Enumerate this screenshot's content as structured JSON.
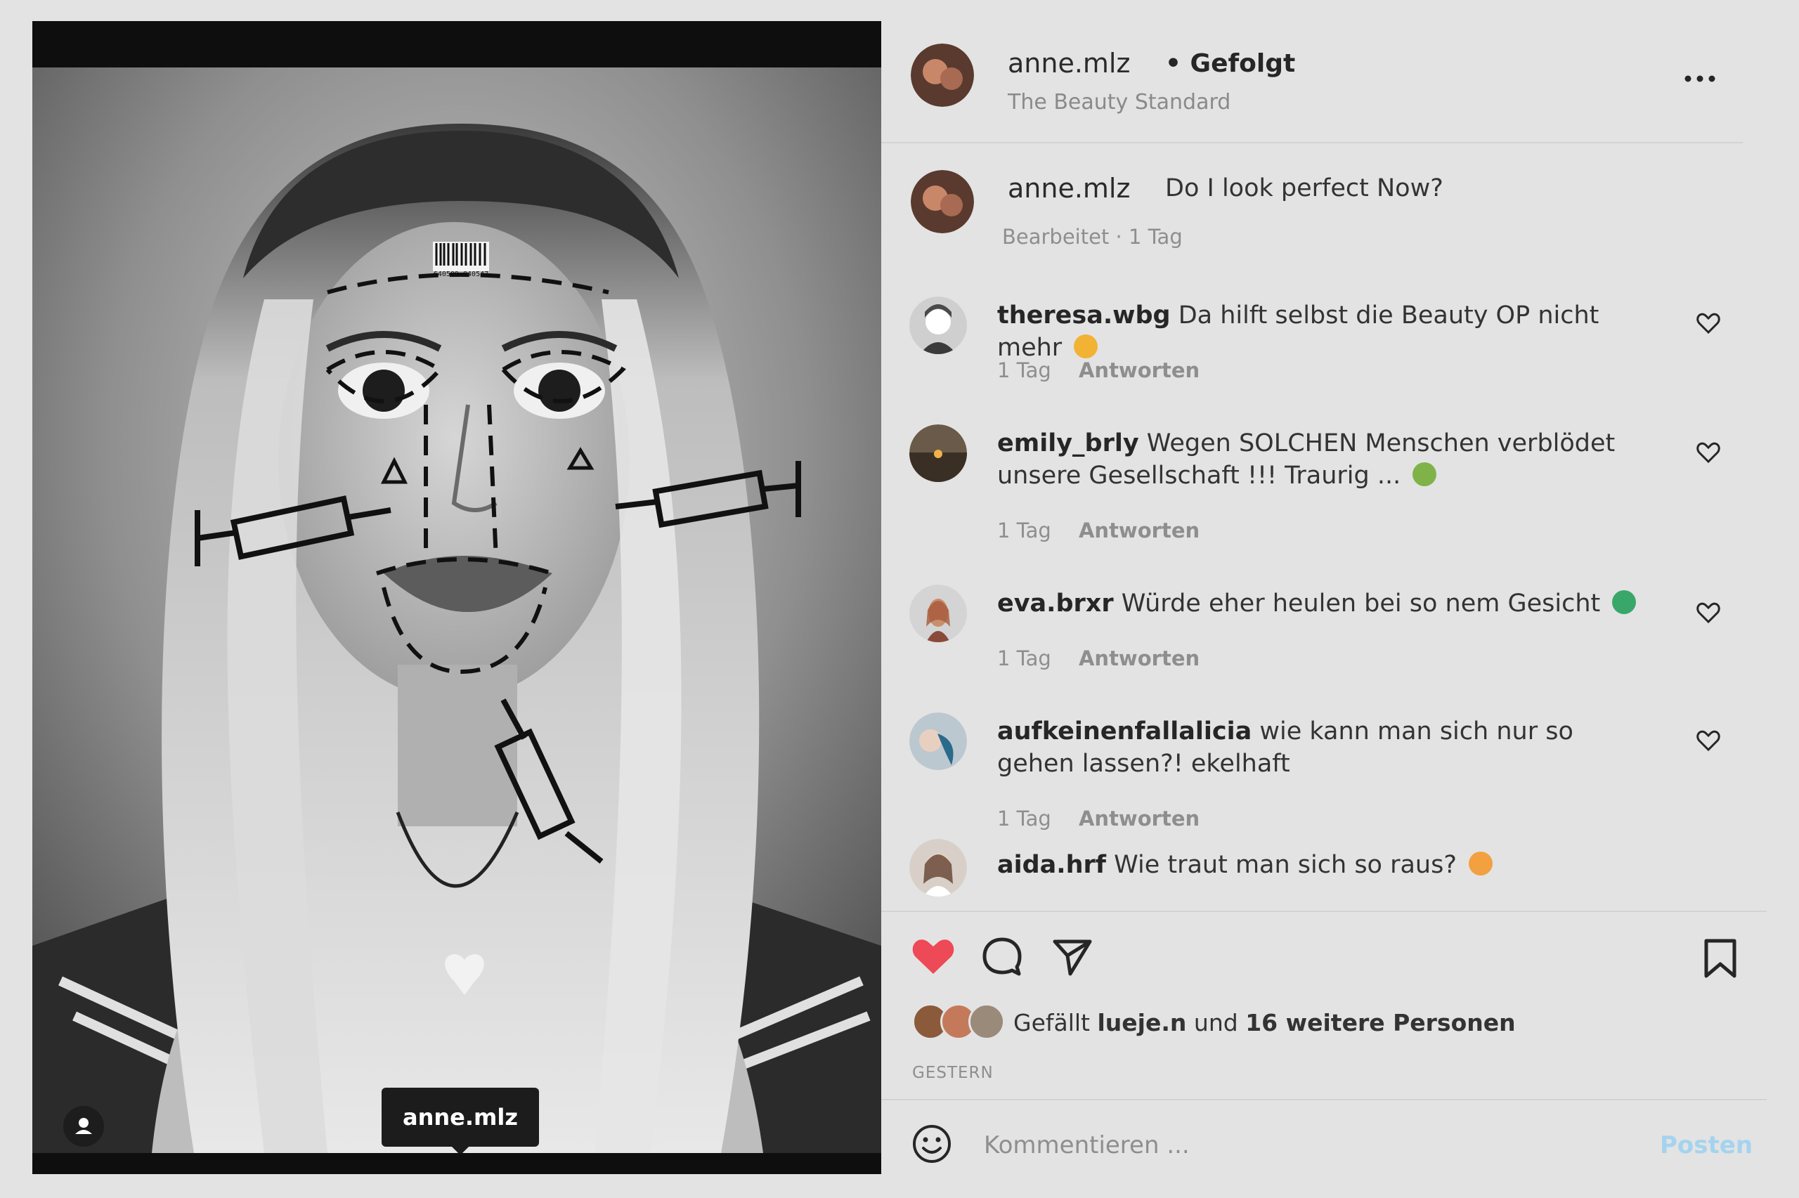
{
  "photo": {
    "tag_username": "anne.mlz",
    "barcode_text": "640509-040547"
  },
  "header": {
    "username": "anne.mlz",
    "follow_status": "• Gefolgt",
    "subtitle": "The Beauty Standard",
    "more_icon": "more-horizontal-icon"
  },
  "caption": {
    "username": "anne.mlz",
    "text": "Do I look perfect Now?",
    "meta": "Bearbeitet · 1 Tag"
  },
  "comments": [
    {
      "user": "theresa.wbg",
      "text": "Da hilft selbst die Beauty OP nicht mehr",
      "emoji": "rolling-eyes",
      "time": "1 Tag",
      "reply": "Antworten"
    },
    {
      "user": "emily_brly",
      "text": "Wegen SOLCHEN Menschen verblödet unsere Gesellschaft !!! Traurig ...",
      "emoji": "nauseated",
      "time": "1 Tag",
      "reply": "Antworten"
    },
    {
      "user": "eva.brxr",
      "text": "Würde eher heulen bei so nem Gesicht",
      "emoji": "sick-green",
      "time": "1 Tag",
      "reply": "Antworten"
    },
    {
      "user": "aufkeinenfallalicia",
      "text": "wie kann man sich nur so gehen lassen?! ekelhaft",
      "emoji": "",
      "time": "1 Tag",
      "reply": "Antworten"
    },
    {
      "user": "aida.hrf",
      "text": "Wie traut man sich so raus?",
      "emoji": "shocked",
      "time": "",
      "reply": ""
    }
  ],
  "actions": {
    "like_icon": "heart-filled-icon",
    "comment_icon": "comment-icon",
    "share_icon": "send-icon",
    "save_icon": "bookmark-icon",
    "like_color": "#ed4956"
  },
  "likes": {
    "prefix": "Gefällt",
    "user": "lueje.n",
    "middle": "und",
    "others": "16 weitere Personen"
  },
  "date": "GESTERN",
  "comment_box": {
    "placeholder": "Kommentieren ...",
    "post_label": "Posten",
    "emoji_icon": "smiley-icon"
  }
}
